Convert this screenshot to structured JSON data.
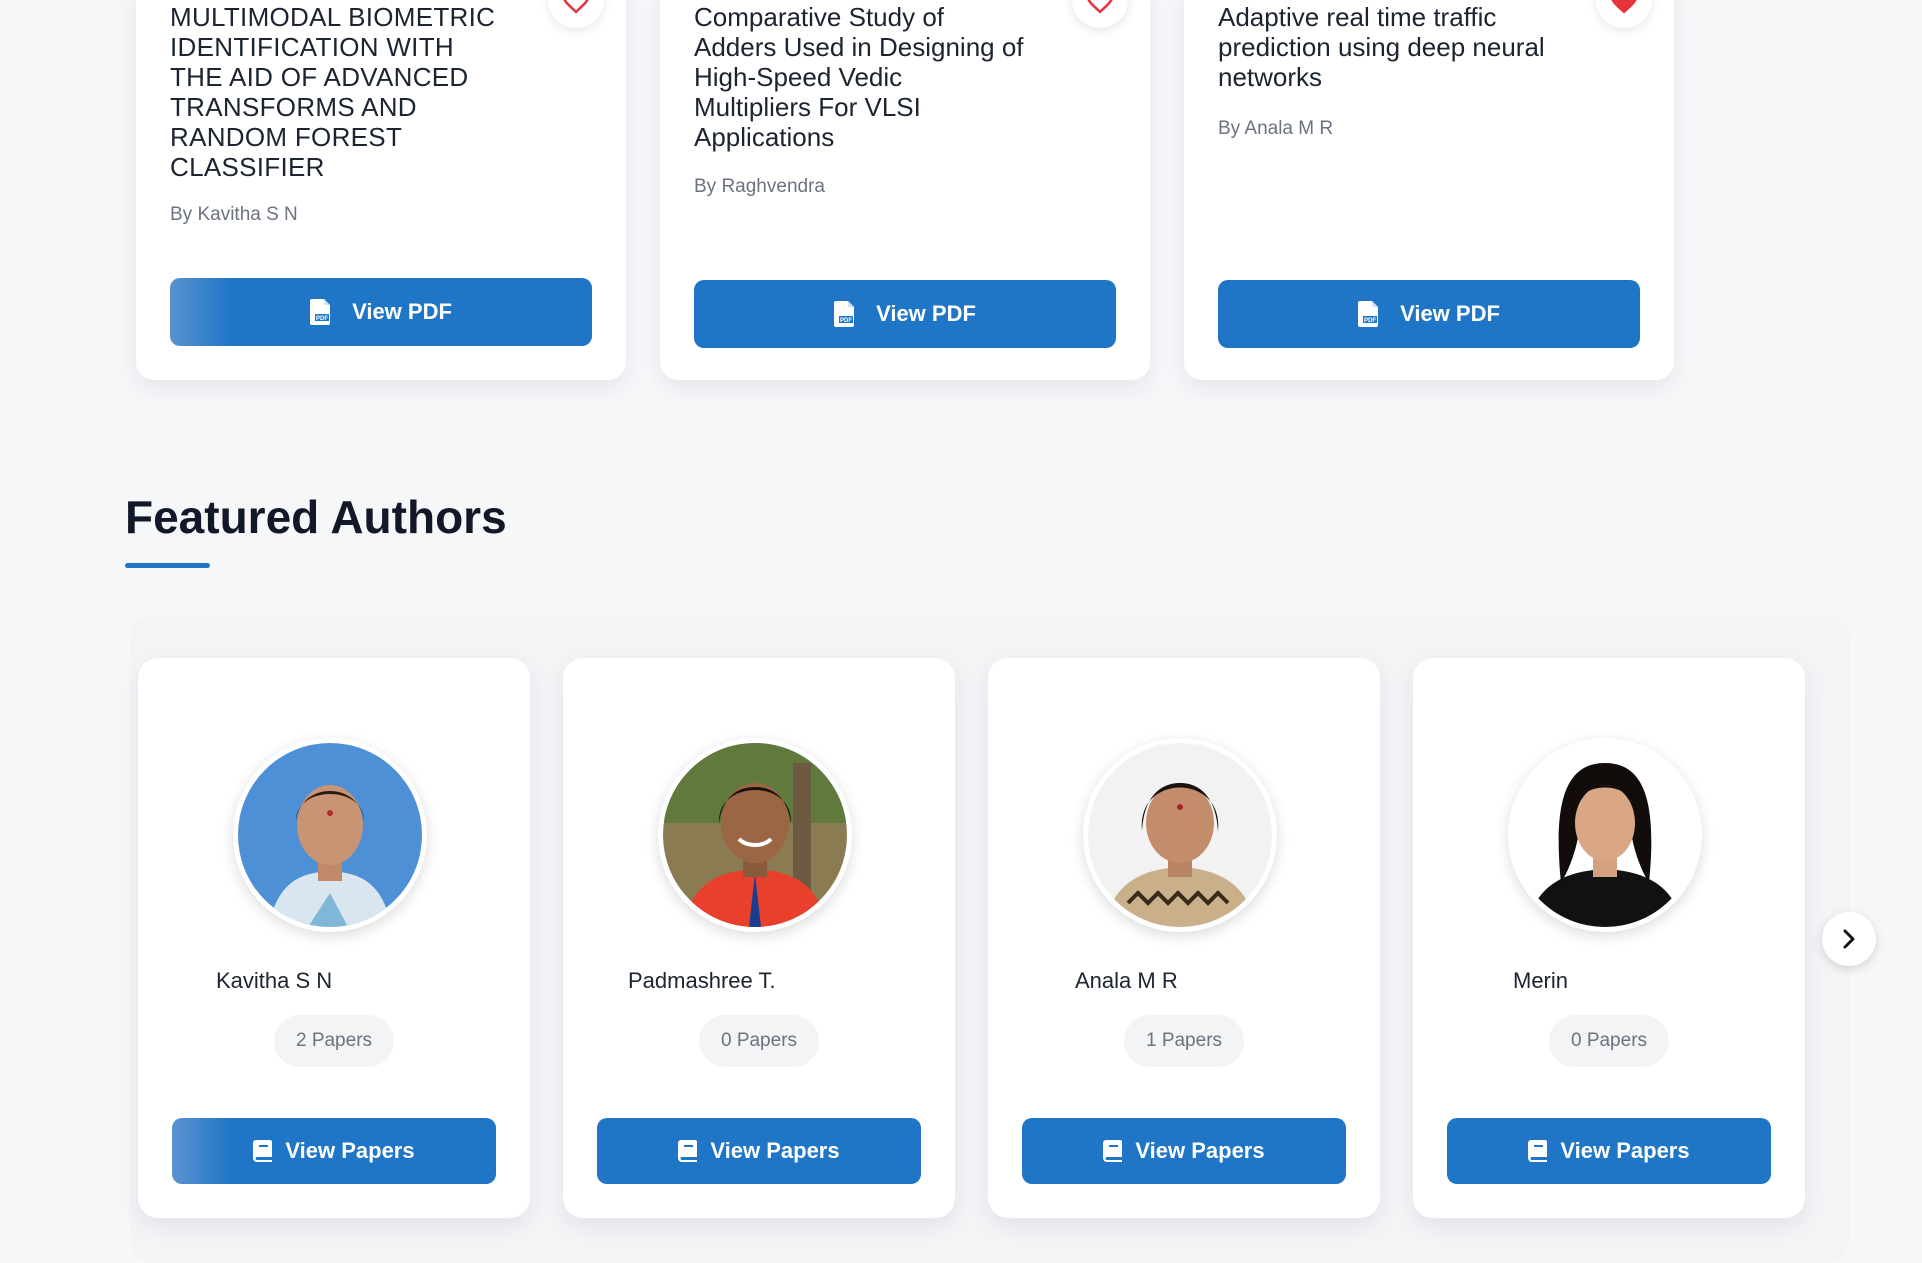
{
  "papers": [
    {
      "title": "MULTIMODAL BIOMETRIC IDENTIFICATION WITH THE AID OF ADVANCED TRANSFORMS AND RANDOM FOREST CLASSIFIER",
      "author": "By Kavitha S N",
      "button": "View PDF",
      "favorited": false
    },
    {
      "title": "Comparative Study of Adders Used in Designing of High-Speed Vedic Multipliers For VLSI Applications",
      "author": "By Raghvendra",
      "button": "View PDF",
      "favorited": false
    },
    {
      "title": "Adaptive real time traffic prediction using deep neural networks",
      "author": "By Anala M R",
      "button": "View PDF",
      "favorited": true
    }
  ],
  "featured": {
    "heading": "Featured Authors",
    "authors": [
      {
        "name": "Kavitha S N",
        "papers": "2 Papers",
        "button": "View Papers"
      },
      {
        "name": "Padmashree T.",
        "papers": "0 Papers",
        "button": "View Papers"
      },
      {
        "name": "Anala M R",
        "papers": "1 Papers",
        "button": "View Papers"
      },
      {
        "name": "Merin",
        "papers": "0 Papers",
        "button": "View Papers"
      }
    ]
  },
  "icons": {
    "favorite": "heart-icon",
    "pdf": "pdf-file-icon",
    "papers": "book-icon",
    "next": "chevron-right-icon"
  },
  "colors": {
    "primary": "#1f76c6",
    "heart": "#e5323b"
  }
}
